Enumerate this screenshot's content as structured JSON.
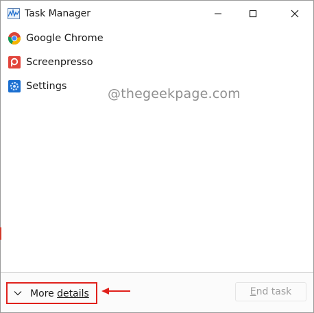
{
  "window": {
    "title": "Task Manager",
    "controls": {
      "minimize": "minimize-icon",
      "maximize": "maximize-icon",
      "close": "close-icon"
    }
  },
  "processes": [
    {
      "name": "Google Chrome",
      "icon": "chrome-icon"
    },
    {
      "name": "Screenpresso",
      "icon": "screenpresso-icon"
    },
    {
      "name": "Settings",
      "icon": "settings-icon"
    }
  ],
  "watermark": "@thegeekpage.com",
  "footer": {
    "more_details_label": "More details",
    "end_task_label": "End task",
    "end_task_enabled": false
  },
  "colors": {
    "highlight_box": "#e0201b",
    "arrow": "#e0201b",
    "disabled_text": "#9e9e9e"
  }
}
